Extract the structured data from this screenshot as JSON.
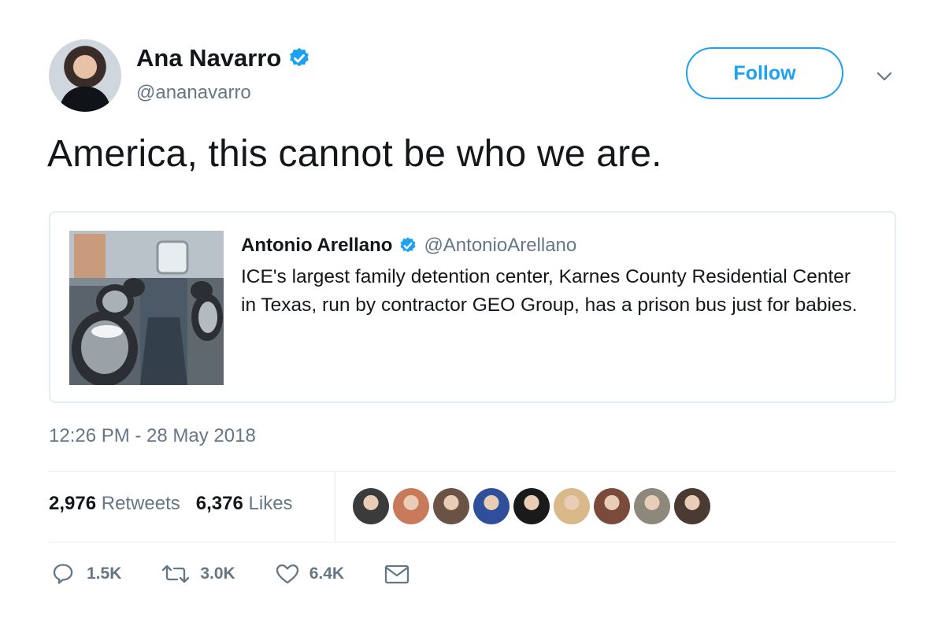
{
  "author": {
    "name": "Ana Navarro",
    "handle": "@ananavarro",
    "verified": true,
    "avatar_icon": "profile-photo"
  },
  "follow_button": {
    "label": "Follow"
  },
  "tweet": {
    "text": "America, this cannot be who we are.",
    "timestamp": "12:26 PM - 28 May 2018"
  },
  "quoted_tweet": {
    "name": "Antonio Arellano",
    "handle": "@AntonioArellano",
    "verified": true,
    "text": "ICE's largest family detention center, Karnes County Residential Center in Texas, run by contractor GEO Group, has a prison bus just for babies.",
    "image_icon": "bus-interior-photo"
  },
  "stats": {
    "retweets_count": "2,976",
    "retweets_label": "Retweets",
    "likes_count": "6,376",
    "likes_label": "Likes"
  },
  "likers": [
    {
      "icon": "liker-avatar-1",
      "color": "#3b3b3b"
    },
    {
      "icon": "liker-avatar-2",
      "color": "#c97a5a"
    },
    {
      "icon": "liker-avatar-3",
      "color": "#6b5244"
    },
    {
      "icon": "liker-avatar-4",
      "color": "#2f4f9a"
    },
    {
      "icon": "liker-avatar-5",
      "color": "#1a1a1a"
    },
    {
      "icon": "liker-avatar-6",
      "color": "#d9b88a"
    },
    {
      "icon": "liker-avatar-7",
      "color": "#7a4a3a"
    },
    {
      "icon": "liker-avatar-8",
      "color": "#8d877c"
    },
    {
      "icon": "liker-avatar-9",
      "color": "#4a3a32"
    }
  ],
  "actions": {
    "replies": "1.5K",
    "retweets": "3.0K",
    "likes": "6.4K"
  },
  "colors": {
    "accent": "#1da1f2",
    "secondary_text": "#657786",
    "primary_text": "#14171a",
    "border": "#e6ecf0"
  }
}
